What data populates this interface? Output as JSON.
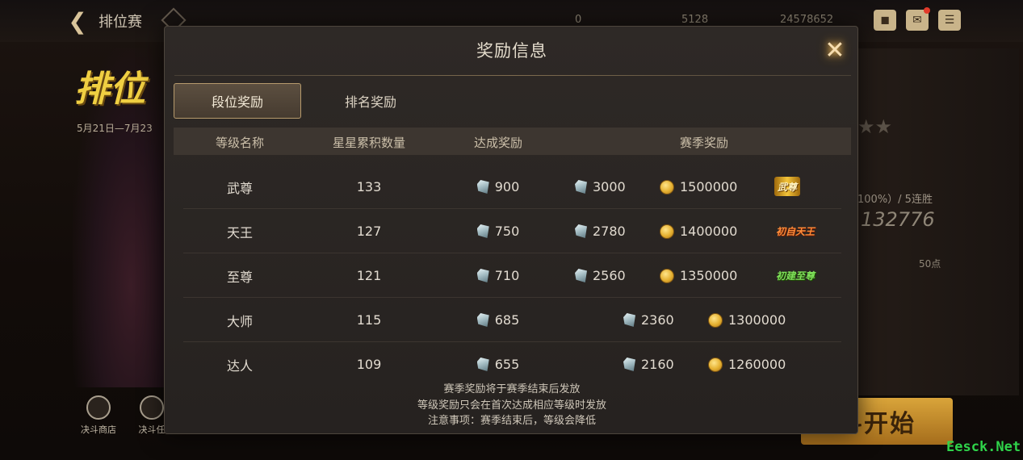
{
  "header": {
    "page_name": "排位赛",
    "currency_1": "0",
    "currency_2": "5128",
    "currency_3": "24578652"
  },
  "background": {
    "event_title": "排位",
    "event_date": "5月21日—7月23",
    "win_rate": "100%）/ 5连胜",
    "score": "132776",
    "points": "50点",
    "start_button": "斗开始",
    "bottom_buttons": [
      "决斗商店",
      "决斗任"
    ],
    "watermark": "Eesck.Net"
  },
  "modal": {
    "title": "奖励信息",
    "tabs": [
      {
        "label": "段位奖励",
        "active": true
      },
      {
        "label": "排名奖励",
        "active": false
      }
    ],
    "columns": [
      "等级名称",
      "星星累积数量",
      "达成奖励",
      "赛季奖励"
    ],
    "rows": [
      {
        "name": "武尊",
        "stars": "133",
        "reach": "900",
        "season_gem": "3000",
        "season_coin": "1500000",
        "badge": "武尊",
        "badge_style": "gold"
      },
      {
        "name": "天王",
        "stars": "127",
        "reach": "750",
        "season_gem": "2780",
        "season_coin": "1400000",
        "badge": "初自天王",
        "badge_style": "red"
      },
      {
        "name": "至尊",
        "stars": "121",
        "reach": "710",
        "season_gem": "2560",
        "season_coin": "1350000",
        "badge": "初建至尊",
        "badge_style": "green"
      },
      {
        "name": "大师",
        "stars": "115",
        "reach": "685",
        "season_gem": "2360",
        "season_coin": "1300000"
      },
      {
        "name": "达人",
        "stars": "109",
        "reach": "655",
        "season_gem": "2160",
        "season_coin": "1260000"
      }
    ],
    "notes": [
      "赛季奖励将于赛季结束后发放",
      "等级奖励只会在首次达成相应等级时发放",
      "注意事项：赛季结束后，等级会降低"
    ]
  },
  "colors": {
    "accent_gold": "#b69a6c",
    "coin": "#e5b030",
    "gem": "#9fb8bf"
  }
}
